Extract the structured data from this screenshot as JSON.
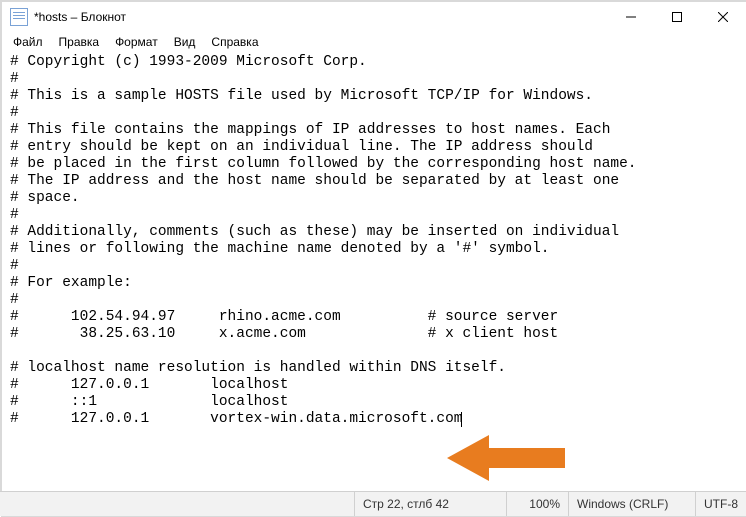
{
  "window": {
    "title": "*hosts – Блокнот"
  },
  "menu": {
    "file": "Файл",
    "edit": "Правка",
    "format": "Формат",
    "view": "Вид",
    "help": "Справка"
  },
  "content": "# Copyright (c) 1993-2009 Microsoft Corp.\n#\n# This is a sample HOSTS file used by Microsoft TCP/IP for Windows.\n#\n# This file contains the mappings of IP addresses to host names. Each\n# entry should be kept on an individual line. The IP address should\n# be placed in the first column followed by the corresponding host name.\n# The IP address and the host name should be separated by at least one\n# space.\n#\n# Additionally, comments (such as these) may be inserted on individual\n# lines or following the machine name denoted by a '#' symbol.\n#\n# For example:\n#\n#      102.54.94.97     rhino.acme.com          # source server\n#       38.25.63.10     x.acme.com              # x client host\n\n# localhost name resolution is handled within DNS itself.\n#      127.0.0.1       localhost\n#      ::1             localhost\n#      127.0.0.1       vortex-win.data.microsoft.com",
  "status": {
    "position": "Стр 22, стлб 42",
    "zoom": "100%",
    "eol": "Windows (CRLF)",
    "encoding": "UTF-8"
  },
  "annotation": {
    "arrow_color": "#e87c1f"
  }
}
